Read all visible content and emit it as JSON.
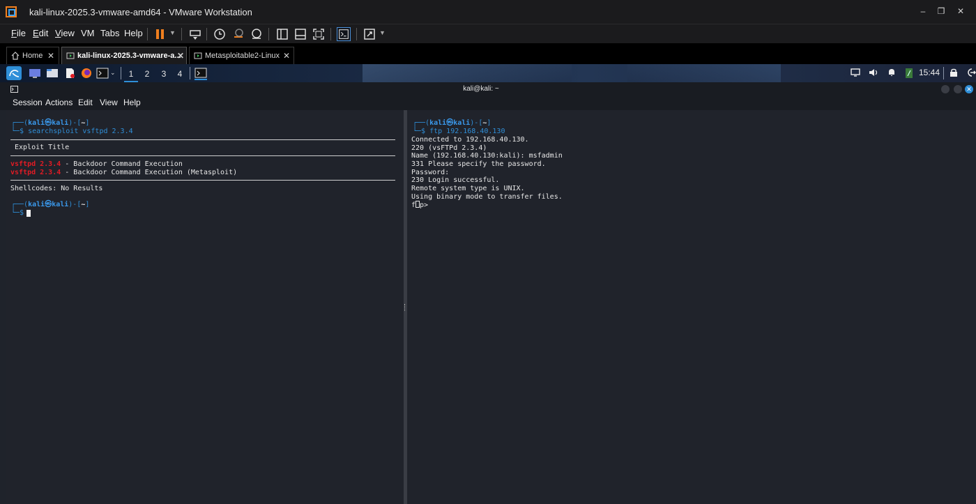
{
  "window": {
    "title": "kali-linux-2025.3-vmware-amd64 - VMware Workstation",
    "controls": [
      "minimize-icon",
      "restore-icon",
      "close-icon"
    ]
  },
  "vm_menu": {
    "items": [
      {
        "label": "File",
        "accel": "F"
      },
      {
        "label": "Edit",
        "accel": "E"
      },
      {
        "label": "View",
        "accel": "V"
      },
      {
        "label": "VM",
        "accel": "M"
      },
      {
        "label": "Tabs",
        "accel": "T"
      },
      {
        "label": "Help",
        "accel": "H"
      }
    ]
  },
  "vm_tabs": [
    {
      "label": "Home",
      "active": false
    },
    {
      "label": "kali-linux-2025.3-vmware-a...",
      "active": true
    },
    {
      "label": "Metasploitable2-Linux",
      "active": false
    }
  ],
  "kali_panel": {
    "workspaces": [
      "1",
      "2",
      "3",
      "4"
    ],
    "active_workspace": "1",
    "clock": "15:44"
  },
  "konsole": {
    "title": "kali@kali: ~",
    "menu": [
      "Session",
      "Actions",
      "Edit",
      "View",
      "Help"
    ]
  },
  "left_terminal": {
    "prompt_user": "kali",
    "prompt_host": "kali",
    "prompt_dir": "~",
    "command": "searchsploit vsftpd 2.3.4",
    "table_header": "Exploit Title",
    "results": [
      {
        "match": "vsftpd 2.3.4",
        "rest": " - Backdoor Command Execution"
      },
      {
        "match": "vsftpd 2.3.4",
        "rest": " - Backdoor Command Execution (Metasploit)"
      }
    ],
    "shellcodes": "Shellcodes: No Results"
  },
  "right_terminal": {
    "prompt_user": "kali",
    "prompt_host": "kali",
    "prompt_dir": "~",
    "command": "ftp 192.168.40.130",
    "output": [
      "Connected to 192.168.40.130.",
      "220 (vsFTPd 2.3.4)",
      "Name (192.168.40.130:kali): msfadmin",
      "331 Please specify the password.",
      "Password:",
      "230 Login successful.",
      "Remote system type is UNIX.",
      "Using binary mode to transfer files."
    ],
    "ftp_prompt_prefix": "f",
    "ftp_prompt_suffix": "p>"
  },
  "colors": {
    "terminal_bg": "#20232b",
    "prompt_blue": "#2f8fd8",
    "match_red": "#e01b24",
    "vmware_orange": "#f07f1e"
  }
}
